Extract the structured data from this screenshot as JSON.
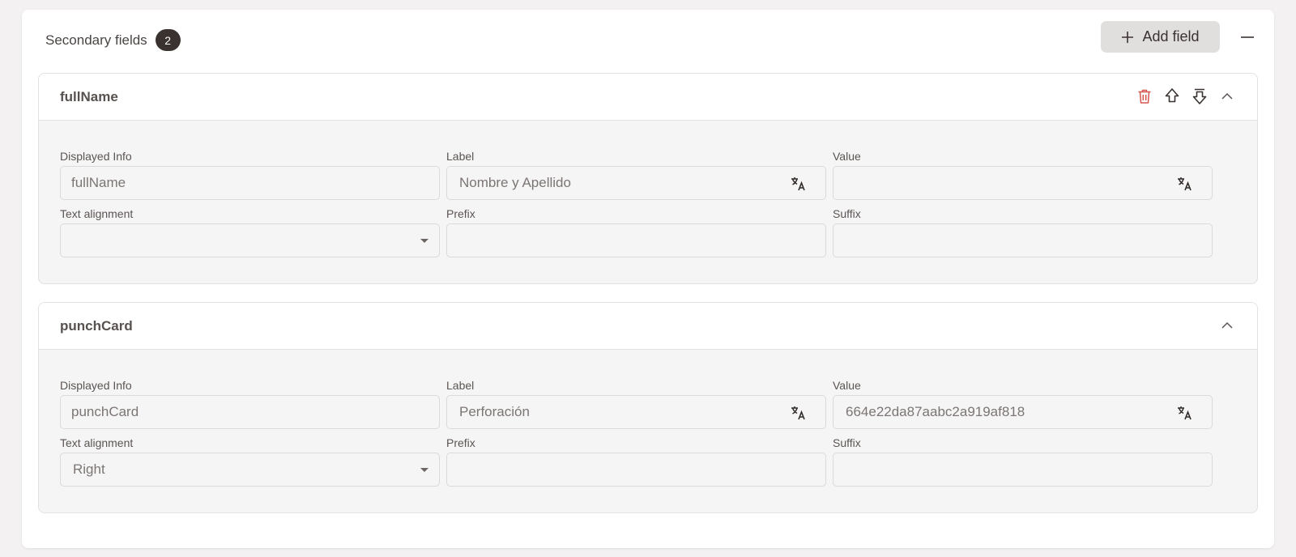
{
  "section": {
    "title": "Secondary fields",
    "count": "2",
    "add_label": "Add field"
  },
  "colors": {
    "badge_bg": "#3a3230",
    "delete_icon": "#d6554f",
    "button_bg": "#e1dfde"
  },
  "labels": {
    "displayed_info": "Displayed Info",
    "label": "Label",
    "value": "Value",
    "text_alignment": "Text alignment",
    "prefix": "Prefix",
    "suffix": "Suffix"
  },
  "fields": [
    {
      "name": "fullName",
      "displayed_info": "fullName",
      "label": "Nombre y Apellido",
      "value": "",
      "text_alignment": "",
      "prefix": "",
      "suffix": "",
      "actions": [
        "trash-icon",
        "move-up-icon",
        "move-down-icon",
        "chevron-up-icon"
      ]
    },
    {
      "name": "punchCard",
      "displayed_info": "punchCard",
      "label": "Perforación",
      "value": "664e22da87aabc2a919af818",
      "text_alignment": "Right",
      "prefix": "",
      "suffix": "",
      "actions": [
        "chevron-up-icon"
      ]
    }
  ]
}
